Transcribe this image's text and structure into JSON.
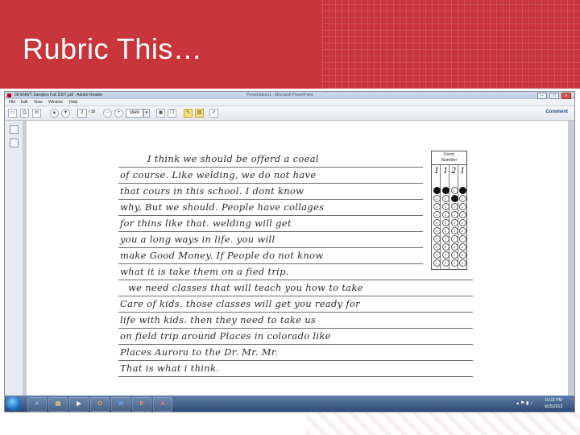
{
  "slide": {
    "title": "Rubric This…"
  },
  "window": {
    "title": "09-ENWT Samples Fall 2007.pdf - Adobe Reader",
    "center_title": "Presentation1 - Microsoft PowerPoint",
    "controls": [
      "–",
      "□",
      "×"
    ]
  },
  "menu": {
    "items": [
      "File",
      "Edit",
      "View",
      "Window",
      "Help"
    ]
  },
  "toolbar": {
    "page_current": "2",
    "page_total": "/ 38",
    "zoom": "184%",
    "comment_label": "Comment",
    "icons": [
      "open-icon",
      "print-icon",
      "email-icon",
      "up-arrow-icon",
      "down-arrow-icon",
      "zoom-out-icon",
      "zoom-in-icon",
      "save-icon",
      "copy-icon",
      "comment-bubble-icon",
      "highlight-icon",
      "sign-icon"
    ]
  },
  "essay": {
    "lines": [
      "I think we should be offerd a coeal",
      "of course. Like welding, we do not have",
      "that cours in this school. I dont know",
      "why, But we should. People have collages",
      "for thins like that. welding will get",
      "you a long ways in life. you will",
      "make Good Money. If People do not know",
      "what it is take them on a fied trip.",
      "we need classes that will teach you how to take",
      "Care of kids. those classes will get you ready for",
      "life with kids. then they need to take us",
      "on field trip around Places in colorado like",
      "Places Aurora to the Dr. Mr. Mr.",
      "That is what i think."
    ]
  },
  "form": {
    "label_line1": "Form",
    "label_line2": "Number",
    "written_digits": [
      "1",
      "1",
      "2",
      "1"
    ],
    "bubble_rows": [
      "1",
      "2",
      "3",
      "4",
      "5",
      "6",
      "7",
      "8",
      "9",
      "0"
    ],
    "filled": [
      [
        0,
        0
      ],
      [
        0,
        1
      ],
      [
        0,
        3
      ],
      [
        1,
        2
      ]
    ]
  },
  "taskbar": {
    "apps": [
      "e",
      "▤",
      "▶",
      "O",
      "W",
      "P",
      "A"
    ],
    "time": "10:22 PM",
    "date": "9/25/2013"
  }
}
